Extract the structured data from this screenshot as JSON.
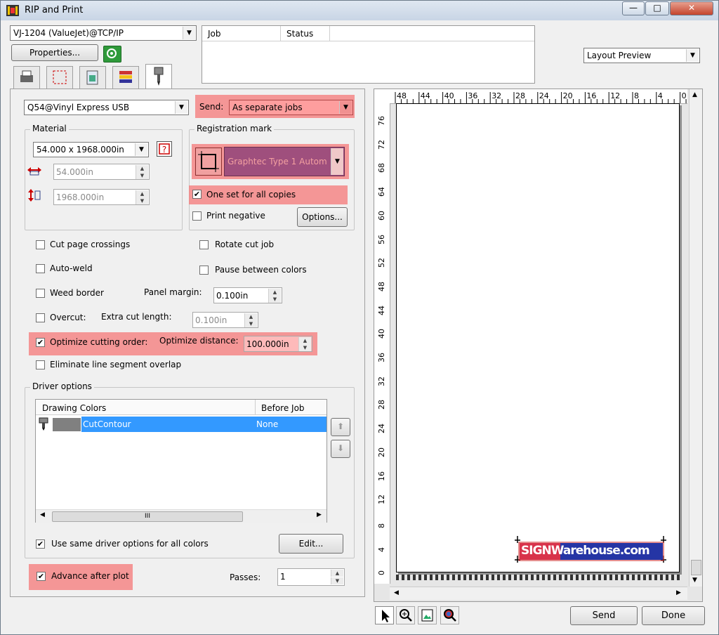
{
  "window": {
    "title": "RIP and Print"
  },
  "printer": {
    "selected": "VJ-1204 (ValueJet)@TCP/IP",
    "properties_label": "Properties..."
  },
  "jobs": {
    "columns": [
      "Job",
      "Status"
    ]
  },
  "preview_mode": {
    "selected": "Layout Preview"
  },
  "cutter": {
    "selected": "Q54@Vinyl Express USB"
  },
  "send": {
    "label": "Send:",
    "selected": "As separate jobs"
  },
  "material": {
    "title": "Material",
    "selected": "54.000 x 1968.000in",
    "width": "54.000in",
    "height": "1968.000in"
  },
  "registration": {
    "title": "Registration mark",
    "selected": "Graphtec Type 1 Autom",
    "one_set_label": "One set for all copies",
    "print_negative_label": "Print negative",
    "options_label": "Options..."
  },
  "options": {
    "cut_page_crossings": "Cut page crossings",
    "rotate_cut_job": "Rotate cut job",
    "auto_weld": "Auto-weld",
    "pause_between_colors": "Pause between colors",
    "weed_border": "Weed border",
    "panel_margin_label": "Panel margin:",
    "panel_margin": "0.100in",
    "overcut": "Overcut:",
    "extra_cut_length_label": "Extra cut length:",
    "extra_cut_length": "0.100in",
    "optimize_cutting_order": "Optimize cutting order:",
    "optimize_distance_label": "Optimize distance:",
    "optimize_distance": "100.000in",
    "eliminate_overlap": "Eliminate line segment overlap"
  },
  "driver": {
    "title": "Driver options",
    "columns": [
      "Drawing Colors",
      "Before Job"
    ],
    "rows": [
      {
        "name": "CutContour",
        "before_job": "None"
      }
    ],
    "same_options_label": "Use same driver options for all colors",
    "edit_label": "Edit...",
    "scroll_grip": "III"
  },
  "advance_after_plot": "Advance after plot",
  "passes": {
    "label": "Passes:",
    "value": "1"
  },
  "ruler": {
    "top": [
      "48",
      "44",
      "40",
      "36",
      "32",
      "28",
      "24",
      "20",
      "16",
      "12",
      "8",
      "4",
      "0"
    ],
    "left": [
      "76",
      "72",
      "68",
      "64",
      "60",
      "56",
      "52",
      "48",
      "44",
      "40",
      "36",
      "32",
      "28",
      "24",
      "20",
      "16",
      "12",
      "8",
      "4",
      "0"
    ]
  },
  "logo": {
    "text": "SIGNWarehouse.com"
  },
  "buttons": {
    "send": "Send",
    "done": "Done"
  },
  "colors": {
    "highlight": "#f57878",
    "selection": "#3399ff",
    "cutcontour_swatch": "#808080"
  }
}
